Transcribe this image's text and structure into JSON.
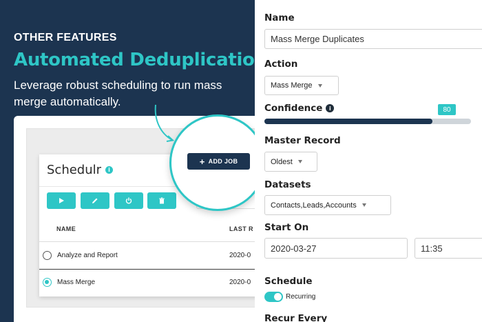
{
  "intro": {
    "eyebrow": "OTHER FEATURES",
    "headline": "Automated Deduplication",
    "description": "Leverage robust scheduling to run mass merge automatically."
  },
  "scheduler": {
    "title": "Schedulr",
    "info_icon": "info-icon",
    "toolbar_icons": [
      "play-icon",
      "edit-pencil-icon",
      "power-icon",
      "trash-icon"
    ],
    "add_job_label": "ADD JOB",
    "columns": {
      "name": "NAME",
      "last_run": "LAST R"
    },
    "rows": [
      {
        "name": "Analyze and Report",
        "date": "2020-0",
        "selected": false
      },
      {
        "name": "Mass Merge",
        "date": "2020-0",
        "selected": true
      }
    ]
  },
  "form": {
    "name_label": "Name",
    "name_value": "Mass Merge Duplicates",
    "action_label": "Action",
    "action_value": "Mass Merge",
    "confidence_label": "Confidence",
    "confidence_value": "80",
    "confidence_fraction": 0.8,
    "master_label": "Master Record",
    "master_value": "Oldest",
    "datasets_label": "Datasets",
    "datasets_value": "Contacts,Leads,Accounts",
    "start_label": "Start On",
    "start_date": "2020-03-27",
    "start_time": "11:35",
    "schedule_label": "Schedule",
    "schedule_toggle_label": "Recurring",
    "recur_label": "Recur Every"
  },
  "colors": {
    "navy": "#1c3450",
    "teal": "#2ec6c6"
  }
}
